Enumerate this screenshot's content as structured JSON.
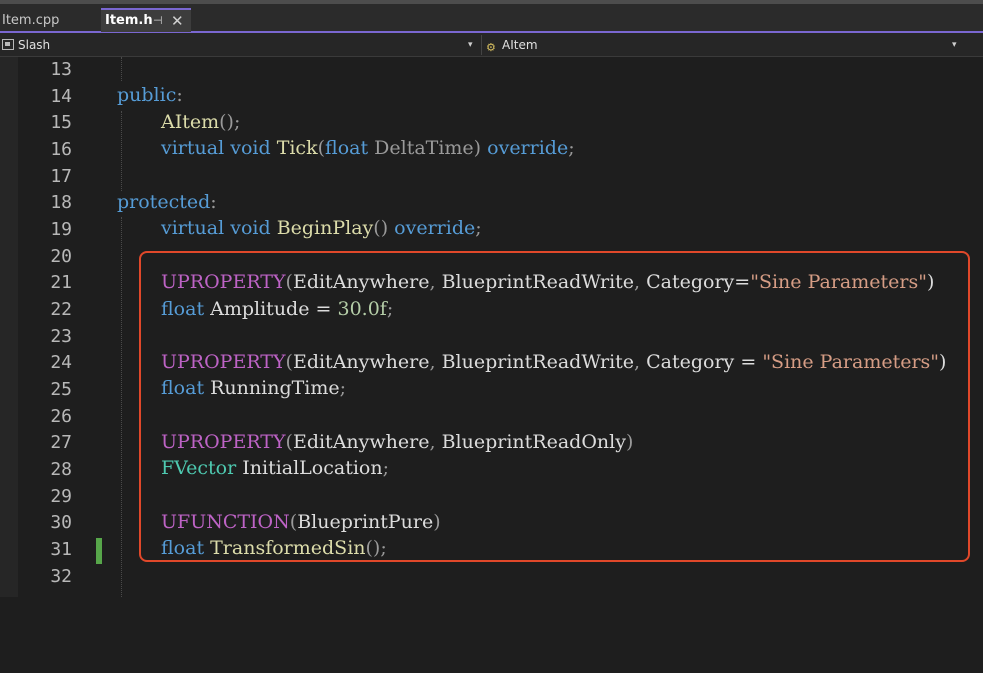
{
  "tabs": [
    {
      "label": "Item.cpp",
      "active": false
    },
    {
      "label": "Item.h",
      "active": true,
      "pin_icon": "pin-icon",
      "close_glyph": "✕"
    }
  ],
  "navbar": {
    "project": "Slash",
    "project_icon": "project-icon",
    "scope": "AItem",
    "scope_icon": "class-icon",
    "dropdown_glyph": "▾"
  },
  "colors": {
    "accent": "#7a67d1",
    "keyword": "#569cd6",
    "function": "#dcdcaa",
    "type": "#4ec9b0",
    "string": "#d69d85",
    "number": "#b5cea8",
    "macro": "#bd63c5",
    "highlight_box": "#e0482a",
    "change_bar": "#57a64a"
  },
  "editor": {
    "line_numbers": [
      "13",
      "14",
      "15",
      "16",
      "17",
      "18",
      "19",
      "20",
      "21",
      "22",
      "23",
      "24",
      "25",
      "26",
      "27",
      "28",
      "29",
      "30",
      "31",
      "32"
    ],
    "lines": {
      "l14": {
        "kw": "public",
        "p": ":"
      },
      "l15": {
        "fn": "AItem",
        "p": "();"
      },
      "l16": {
        "kw1": "virtual",
        "kw2": "void",
        "fn": "Tick",
        "p1": "(",
        "kw3": "float",
        "param": "DeltaTime",
        "p2": ")",
        "kw4": "override",
        "p3": ";"
      },
      "l18": {
        "kw": "protected",
        "p": ":"
      },
      "l19": {
        "kw1": "virtual",
        "kw2": "void",
        "fn": "BeginPlay",
        "p1": "()",
        "kw3": "override",
        "p2": ";"
      },
      "l21": {
        "mc": "UPROPERTY",
        "p1": "(",
        "a1": "EditAnywhere",
        "p2": ",",
        "a2": "BlueprintReadWrite",
        "p3": ",",
        "a3": "Category=",
        "st": "\"Sine Parameters\"",
        "p4": ")"
      },
      "l22": {
        "kw": "float",
        "id": "Amplitude",
        "op": "=",
        "nm": "30.0f",
        "p": ";"
      },
      "l24": {
        "mc": "UPROPERTY",
        "p1": "(",
        "a1": "EditAnywhere",
        "p2": ",",
        "a2": "BlueprintReadWrite",
        "p3": ",",
        "a3": "Category",
        "op": "=",
        "st": "\"Sine Parameters\"",
        "p4": ")"
      },
      "l25": {
        "kw": "float",
        "id": "RunningTime",
        "p": ";"
      },
      "l27": {
        "mc": "UPROPERTY",
        "p1": "(",
        "a1": "EditAnywhere",
        "p2": ",",
        "a2": "BlueprintReadOnly",
        "p3": ")"
      },
      "l28": {
        "ty": "FVector",
        "id": "InitialLocation",
        "p": ";"
      },
      "l30": {
        "mc": "UFUNCTION",
        "p1": "(",
        "a1": "BlueprintPure",
        "p2": ")"
      },
      "l31": {
        "kw": "float",
        "fn": "TransformedSin",
        "p": "();"
      }
    }
  }
}
